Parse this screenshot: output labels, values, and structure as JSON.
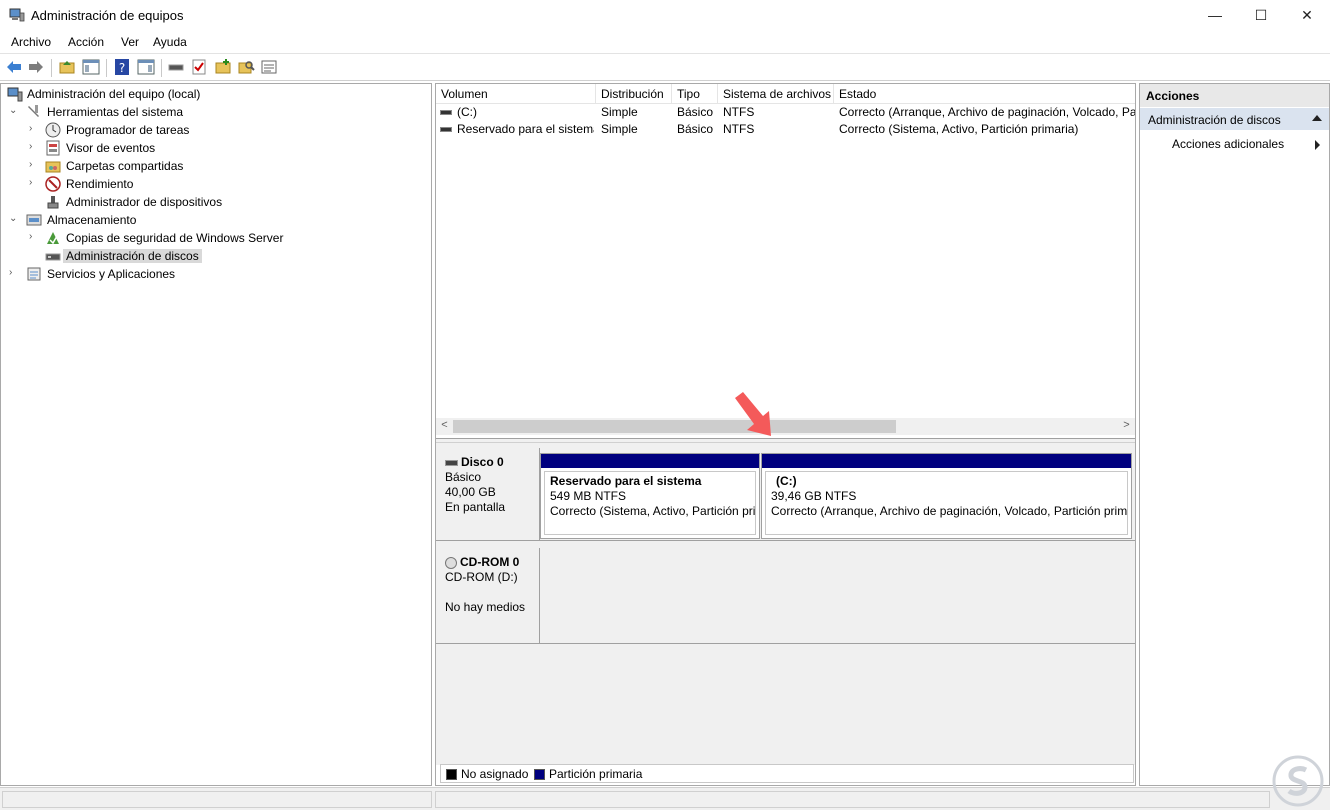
{
  "window": {
    "title": "Administración de equipos",
    "minimize": "—",
    "maximize": "☐",
    "close": "✕"
  },
  "menu": [
    "Archivo",
    "Acción",
    "Ver",
    "Ayuda"
  ],
  "tree": {
    "root": "Administración del equipo (local)",
    "items": [
      {
        "label": "Herramientas del sistema"
      },
      {
        "label": "Programador de tareas"
      },
      {
        "label": "Visor de eventos"
      },
      {
        "label": "Carpetas compartidas"
      },
      {
        "label": "Rendimiento"
      },
      {
        "label": "Administrador de dispositivos"
      },
      {
        "label": "Almacenamiento"
      },
      {
        "label": "Copias de seguridad de Windows Server"
      },
      {
        "label": "Administración de discos"
      },
      {
        "label": "Servicios y Aplicaciones"
      }
    ]
  },
  "volumes": {
    "columns": [
      "Volumen",
      "Distribución",
      "Tipo",
      "Sistema de archivos",
      "Estado"
    ],
    "rows": [
      [
        "(C:)",
        "Simple",
        "Básico",
        "NTFS",
        "Correcto (Arranque, Archivo de paginación, Volcado, Pa"
      ],
      [
        "Reservado para el sistema",
        "Simple",
        "Básico",
        "NTFS",
        "Correcto (Sistema, Activo, Partición primaria)"
      ]
    ]
  },
  "scroll": {
    "left": "<",
    "right": ">"
  },
  "disks": {
    "disk0": {
      "name": "Disco 0",
      "type": "Básico",
      "size": "40,00 GB",
      "state": "En pantalla",
      "partitions": [
        {
          "name": "Reservado para el sistema",
          "size": "549 MB NTFS",
          "status": "Correcto (Sistema, Activo, Partición pri"
        },
        {
          "name": "(C:)",
          "size": "39,46 GB NTFS",
          "status": "Correcto (Arranque, Archivo de paginación, Volcado, Partición prim"
        }
      ]
    },
    "cdrom0": {
      "name": "CD-ROM 0",
      "drive": "CD-ROM (D:)",
      "state": "No hay medios"
    }
  },
  "legend": {
    "unallocated": "No asignado",
    "primary": "Partición primaria",
    "unallocated_color": "#000000",
    "primary_color": "#00007f"
  },
  "actions": {
    "header": "Acciones",
    "section": "Administración de discos",
    "item": "Acciones adicionales"
  }
}
